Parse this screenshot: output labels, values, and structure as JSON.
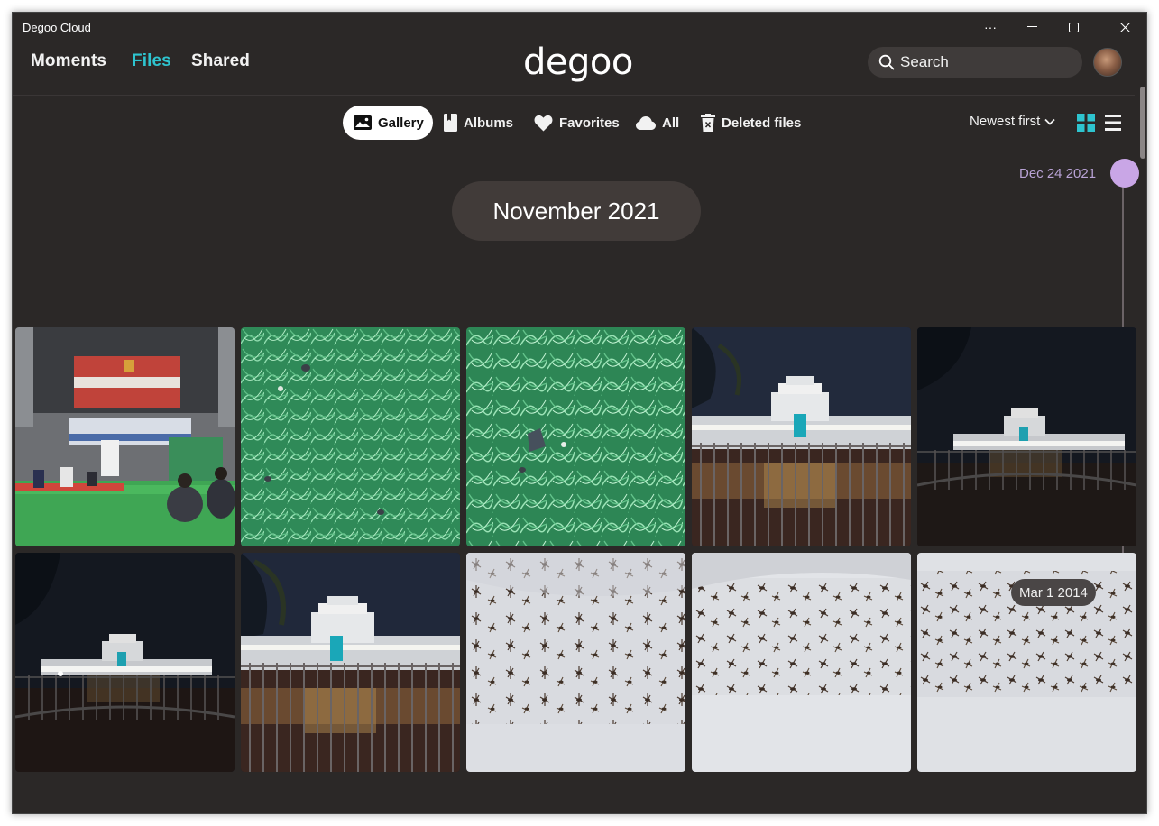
{
  "window": {
    "title": "Degoo Cloud"
  },
  "window_controls": {
    "more": "···",
    "minimize": "—",
    "maximize": "☐",
    "close": "✕"
  },
  "nav": {
    "moments": "Moments",
    "files": "Files",
    "shared": "Shared"
  },
  "logo": "degoo",
  "search": {
    "placeholder": "Search"
  },
  "toolbar": {
    "gallery": "Gallery",
    "albums": "Albums",
    "favorites": "Favorites",
    "all": "All",
    "deleted": "Deleted files",
    "sort": "Newest first"
  },
  "timeline": {
    "top_date": "Dec 24 2021",
    "bubble_date": "Mar 1 2014"
  },
  "section": {
    "month": "November 2021"
  },
  "colors": {
    "accent": "#2ec4cf",
    "background": "#2b2827",
    "timeline": "#c9a6e6"
  },
  "photos": [
    {
      "kind": "event-tent"
    },
    {
      "kind": "grass"
    },
    {
      "kind": "grass"
    },
    {
      "kind": "night-building"
    },
    {
      "kind": "night-building-far"
    },
    {
      "kind": "night-building-far"
    },
    {
      "kind": "night-building"
    },
    {
      "kind": "insects"
    },
    {
      "kind": "insects"
    },
    {
      "kind": "insects"
    }
  ]
}
